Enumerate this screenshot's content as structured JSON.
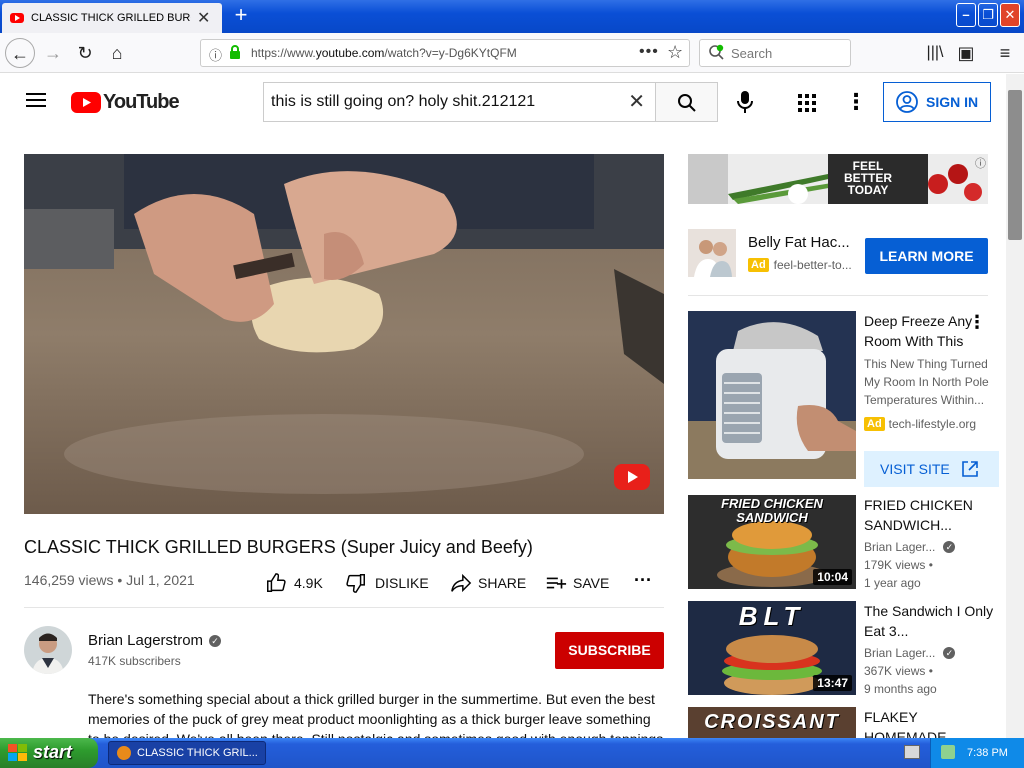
{
  "browser": {
    "tab_title": "CLASSIC THICK GRILLED BURGERS",
    "url_prefix": "https://www.",
    "url_host": "youtube.com",
    "url_path": "/watch?v=y-Dg6KYtQFM",
    "search_placeholder": "Search"
  },
  "youtube": {
    "logo_text": "YouTube",
    "search_query": "this is still going on? holy shit.212121",
    "sign_in": "SIGN IN"
  },
  "video": {
    "title": "CLASSIC THICK GRILLED BURGERS (Super Juicy and Beefy)",
    "meta": "146,259 views • Jul 1, 2021",
    "likes": "4.9K",
    "dislike": "DISLIKE",
    "share": "SHARE",
    "save": "SAVE"
  },
  "channel": {
    "name": "Brian Lagerstrom",
    "subscribers": "417K subscribers",
    "subscribe": "SUBSCRIBE"
  },
  "description": "There's something special about a thick grilled burger in the summertime. But even the best memories of the puck of grey meat product moonlighting as a thick burger leave something to be desired. We've all been there. Still nostalgic and sometimes good with enough toppings",
  "sidebar": {
    "banner_ad": {
      "text": "FEEL BETTER TODAY"
    },
    "ad1": {
      "title": "Belly Fat Hac...",
      "badge": "Ad",
      "domain": "feel-better-to...",
      "cta": "LEARN MORE"
    },
    "ad2": {
      "title": "Deep Freeze Any Room With This",
      "desc": "This New Thing Turned My Room In North Pole Temperatures Within...",
      "badge": "Ad",
      "domain": "tech-lifestyle.org",
      "cta": "VISIT SITE"
    },
    "videos": [
      {
        "thumb_text": "FRIED CHICKEN SANDWICH",
        "title": "FRIED CHICKEN SANDWICH...",
        "channel": "Brian Lager...",
        "views": "179K views •",
        "age": "1 year ago",
        "duration": "10:04"
      },
      {
        "thumb_text": "BLT",
        "title": "The Sandwich I Only Eat 3...",
        "channel": "Brian Lager...",
        "views": "367K views •",
        "age": "9 months ago",
        "duration": "13:47"
      },
      {
        "thumb_text": "CROISSANT",
        "title": "FLAKEY HOMEMADE",
        "channel": "",
        "views": "",
        "age": "",
        "duration": ""
      }
    ]
  },
  "taskbar": {
    "start": "start",
    "task": "CLASSIC THICK GRIL...",
    "time": "7:38 PM"
  }
}
